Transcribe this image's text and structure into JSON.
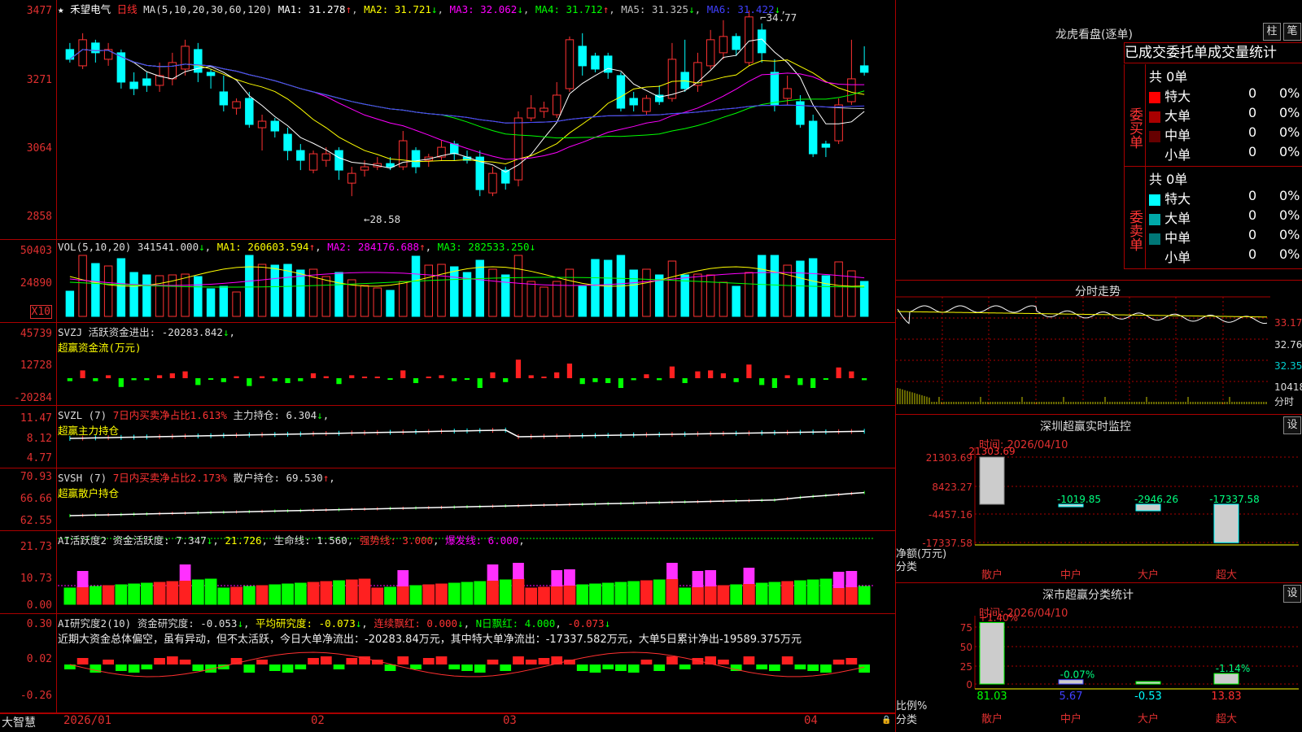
{
  "stock": {
    "name": "禾望电气",
    "period": "日线"
  },
  "k": {
    "ma_params": "MA(5,10,20,30,60,120)",
    "ma": [
      {
        "label": "MA1: 31.278",
        "arrow": "↑",
        "color": "#ffffff"
      },
      {
        "label": "MA2: 31.721",
        "arrow": "↓",
        "color": "#ffff00"
      },
      {
        "label": "MA3: 32.062",
        "arrow": "↓",
        "color": "#ff00ff"
      },
      {
        "label": "MA4: 31.712",
        "arrow": "↑",
        "color": "#00ff00"
      },
      {
        "label": "MA5: 31.325",
        "arrow": "↓",
        "color": "#c0c0c0"
      },
      {
        "label": "MA6: 31.422",
        "arrow": "↓",
        "color": "#4040ff"
      }
    ],
    "yticks": [
      "3477",
      "3271",
      "3064",
      "2858"
    ],
    "high_label": "34.77",
    "low_label": "←28.58",
    "ylim": [
      28.58,
      34.77
    ]
  },
  "vol": {
    "head": "VOL(5,10,20)",
    "value": "341541.000",
    "v_arrow": "↓",
    "ma1": "MA1: 260603.594",
    "ma1_arrow": "↑",
    "ma2": "MA2: 284176.688",
    "ma2_arrow": "↑",
    "ma3": "MA3: 282533.250",
    "ma3_arrow": "↓",
    "yticks": [
      "50403",
      "24890"
    ],
    "unit": "X10"
  },
  "svzj": {
    "head": "SVZJ",
    "label": "活跃资金进出: -20283.842",
    "arrow": "↓",
    "sub": "超赢资金流(万元)",
    "yticks": [
      "45739",
      "12728",
      "-20284"
    ]
  },
  "svzl": {
    "head": "SVZL (7)",
    "t1": "7日内买卖净占比1.613%",
    "t2": "主力持仓: 6.304",
    "arrow": "↓",
    "sub": "超赢主力持仓",
    "yticks": [
      "11.47",
      "8.12",
      "4.77"
    ]
  },
  "svsh": {
    "head": "SVSH (7)",
    "t1": "7日内买卖净占比2.173%",
    "t2": "散户持仓: 69.530",
    "arrow": "↑",
    "sub": "超赢散户持仓",
    "yticks": [
      "70.93",
      "66.66",
      "62.55"
    ]
  },
  "ai1": {
    "head": "AI活跃度2",
    "t1": "资金活跃度: 7.347",
    "a1": "↓",
    "t2": "21.726",
    "t3": "生命线: 1.560",
    "t4": "强势线: 3.000",
    "t5": "爆发线: 6.000",
    "yticks": [
      "21.73",
      "10.73",
      "0.00"
    ]
  },
  "ai2": {
    "head": "AI研究度2(10)",
    "t1": "资金研究度: -0.053",
    "a1": "↓",
    "t2": "平均研究度: -0.073",
    "a2": "↓",
    "t3": "连续飘红: 0.000",
    "a3": "↓",
    "t4": "N日飘红: 4.000",
    "t5": "-0.073",
    "a5": "↓",
    "note": "近期大资金总体偏空，虽有异动，但不太活跃，今日大单净流出：-20283.84万元，其中特大单净流出：-17337.582万元，大单5日累计净出-19589.375万元",
    "yticks": [
      "0.30",
      "0.02",
      "-0.26"
    ]
  },
  "xaxis": {
    "logo": "大智慧",
    "dates": [
      "2026/01",
      "02",
      "03",
      "04"
    ]
  },
  "longhu": {
    "title": "龙虎看盘(逐单)",
    "btn1": "柱",
    "btn2": "笔",
    "tabs": [
      "已成交",
      "委托单",
      "成交量统计"
    ],
    "buy": {
      "side": "委买单",
      "total": "共 0单",
      "rows": [
        {
          "name": "特大",
          "color": "#ff0000",
          "n": "0",
          "p": "0%"
        },
        {
          "name": "大单",
          "color": "#aa0000",
          "n": "0",
          "p": "0%"
        },
        {
          "name": "中单",
          "color": "#660000",
          "n": "0",
          "p": "0%"
        },
        {
          "name": "小单",
          "color": "#000000",
          "n": "0",
          "p": "0%"
        }
      ]
    },
    "sell": {
      "side": "委卖单",
      "total": "共 0单",
      "rows": [
        {
          "name": "特大",
          "color": "#00ffff",
          "n": "0",
          "p": "0%"
        },
        {
          "name": "大单",
          "color": "#00aaaa",
          "n": "0",
          "p": "0%"
        },
        {
          "name": "中单",
          "color": "#007777",
          "n": "0",
          "p": "0%"
        },
        {
          "name": "小单",
          "color": "#000000",
          "n": "0",
          "p": "0%"
        }
      ]
    }
  },
  "minute": {
    "title": "分时走势",
    "yticks": [
      "33.17",
      "32.76",
      "32.35"
    ],
    "vol_label": "10418",
    "vol_unit": "分时"
  },
  "monitor": {
    "title": "深圳超赢实时监控",
    "btn": "设",
    "time": "时间: 2026/04/10",
    "yticks": [
      "21303.69",
      "8423.27",
      "-4457.16",
      "-17337.58"
    ],
    "ylabel": "净额(万元)",
    "xlabel": "分类",
    "cats": [
      "散户",
      "中户",
      "大户",
      "超大"
    ],
    "values": [
      21303.69,
      -1019.85,
      -2946.26,
      -17337.58
    ],
    "value_labels": [
      "21303.69",
      "-1019.85",
      "-2946.26",
      "-17337.58"
    ]
  },
  "category": {
    "title": "深市超赢分类统计",
    "btn": "设",
    "time": "时间: 2026/04/10",
    "yticks": [
      "75",
      "50",
      "25",
      "0"
    ],
    "ylabel": "比例%",
    "xlabel": "分类",
    "cats": [
      "散户",
      "中户",
      "大户",
      "超大"
    ],
    "pct_labels": [
      "+1.40%",
      "-0.07%",
      "",
      "-1.14%"
    ],
    "bottom_vals": [
      "81.03",
      "5.67",
      "-0.53",
      "13.83"
    ],
    "values": [
      81.03,
      5.67,
      -0.53,
      13.83
    ]
  },
  "chart_data": {
    "type": "candlestick",
    "series": [
      {
        "values": [
          [
            33.6,
            33.3,
            33.8,
            33.2
          ],
          [
            33.1,
            33.9,
            34.1,
            33.0
          ],
          [
            33.8,
            33.5,
            33.9,
            33.2
          ],
          [
            33.3,
            33.6,
            33.8,
            33.1
          ],
          [
            33.5,
            32.6,
            33.6,
            32.4
          ],
          [
            32.6,
            32.4,
            32.9,
            32.2
          ],
          [
            32.7,
            32.5,
            32.9,
            32.3
          ],
          [
            32.5,
            32.8,
            33.2,
            32.3
          ],
          [
            32.7,
            33.2,
            33.5,
            32.5
          ],
          [
            33.0,
            33.7,
            33.9,
            32.8
          ],
          [
            33.6,
            32.9,
            33.8,
            32.6
          ],
          [
            32.9,
            32.8,
            33.0,
            32.4
          ],
          [
            32.3,
            31.9,
            32.8,
            31.7
          ],
          [
            31.8,
            32.0,
            32.1,
            31.6
          ],
          [
            32.1,
            31.3,
            32.3,
            31.2
          ],
          [
            31.2,
            31.4,
            31.6,
            30.5
          ],
          [
            31.4,
            31.1,
            31.5,
            30.9
          ],
          [
            31.0,
            30.5,
            31.2,
            30.2
          ],
          [
            30.5,
            30.2,
            30.7,
            29.9
          ],
          [
            29.9,
            30.4,
            30.5,
            29.8
          ],
          [
            30.2,
            30.4,
            30.6,
            30.0
          ],
          [
            30.5,
            29.9,
            30.6,
            29.6
          ],
          [
            29.5,
            29.8,
            30.0,
            29.1
          ],
          [
            29.9,
            30.0,
            30.2,
            29.7
          ],
          [
            30.0,
            30.1,
            30.3,
            29.9
          ],
          [
            30.1,
            30.0,
            30.3,
            29.9
          ],
          [
            30.0,
            30.8,
            31.1,
            29.9
          ],
          [
            30.5,
            30.0,
            30.6,
            29.8
          ],
          [
            30.2,
            30.3,
            30.4,
            30.0
          ],
          [
            30.3,
            30.6,
            30.8,
            30.2
          ],
          [
            30.7,
            30.4,
            30.8,
            30.2
          ],
          [
            30.3,
            30.2,
            30.5,
            30.1
          ],
          [
            30.3,
            29.3,
            30.5,
            29.1
          ],
          [
            29.2,
            29.8,
            30.0,
            29.1
          ],
          [
            29.9,
            29.5,
            30.0,
            29.3
          ],
          [
            29.6,
            31.5,
            31.7,
            29.4
          ],
          [
            31.5,
            31.8,
            32.2,
            31.4
          ],
          [
            31.7,
            31.8,
            32.0,
            31.5
          ],
          [
            31.6,
            32.2,
            32.6,
            31.5
          ],
          [
            32.4,
            33.9,
            34.0,
            32.3
          ],
          [
            33.7,
            33.1,
            34.1,
            32.8
          ],
          [
            33.4,
            33.0,
            33.5,
            32.9
          ],
          [
            33.4,
            32.9,
            33.5,
            32.7
          ],
          [
            32.8,
            31.8,
            32.9,
            31.7
          ],
          [
            32.1,
            31.9,
            32.3,
            31.7
          ],
          [
            31.7,
            32.1,
            32.2,
            31.6
          ],
          [
            32.2,
            32.0,
            32.5,
            31.9
          ],
          [
            32.1,
            33.3,
            33.8,
            32.0
          ],
          [
            32.9,
            32.4,
            33.9,
            32.3
          ],
          [
            32.5,
            33.2,
            33.5,
            32.3
          ],
          [
            33.1,
            33.9,
            34.2,
            33.0
          ],
          [
            33.5,
            34.0,
            34.5,
            33.3
          ],
          [
            34.0,
            33.6,
            34.1,
            33.4
          ],
          [
            33.2,
            34.6,
            34.8,
            33.1
          ],
          [
            34.2,
            33.5,
            34.4,
            33.2
          ],
          [
            32.9,
            31.9,
            33.3,
            31.7
          ],
          [
            32.1,
            32.4,
            32.8,
            31.9
          ],
          [
            32.0,
            31.3,
            32.2,
            31.2
          ],
          [
            31.4,
            30.4,
            31.6,
            30.3
          ],
          [
            30.7,
            30.6,
            30.8,
            30.3
          ],
          [
            30.8,
            31.9,
            32.1,
            30.7
          ],
          [
            32.0,
            32.7,
            33.9,
            31.9
          ],
          [
            33.1,
            32.9,
            33.7,
            32.8
          ]
        ]
      }
    ],
    "ylim": [
      28.58,
      34.77
    ]
  }
}
